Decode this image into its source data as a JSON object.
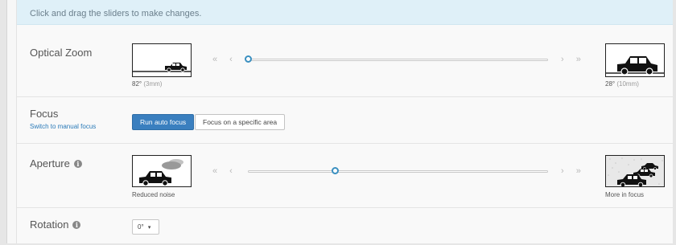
{
  "notice": "Click and drag the sliders to make changes.",
  "zoom": {
    "label": "Optical Zoom",
    "left_caption": "82°",
    "left_caption_sub": "(3mm)",
    "right_caption": "28°",
    "right_caption_sub": "(10mm)",
    "arrows_left": "« ‹",
    "arrows_right": "› »",
    "position": 0.0
  },
  "focus": {
    "label": "Focus",
    "manual_link": "Switch to manual focus",
    "auto_button": "Run auto focus",
    "area_button": "Focus on a specific area"
  },
  "aperture": {
    "label": "Aperture",
    "info_icon": "i",
    "left_caption": "Reduced noise",
    "right_caption": "More in focus",
    "arrows_left": "« ‹",
    "arrows_right": "› »",
    "position": 0.29
  },
  "rotation": {
    "label": "Rotation",
    "info_icon": "i",
    "value": "0°",
    "caret": "▾"
  },
  "icons": [
    "car-icon",
    "info-icon",
    "caret-down-icon",
    "double-chevron-left-icon",
    "chevron-left-icon",
    "chevron-right-icon",
    "double-chevron-right-icon"
  ],
  "colors": {
    "accent": "#3a7fbf",
    "notice_bg": "#dff0f8",
    "link": "#2a7ab8"
  }
}
